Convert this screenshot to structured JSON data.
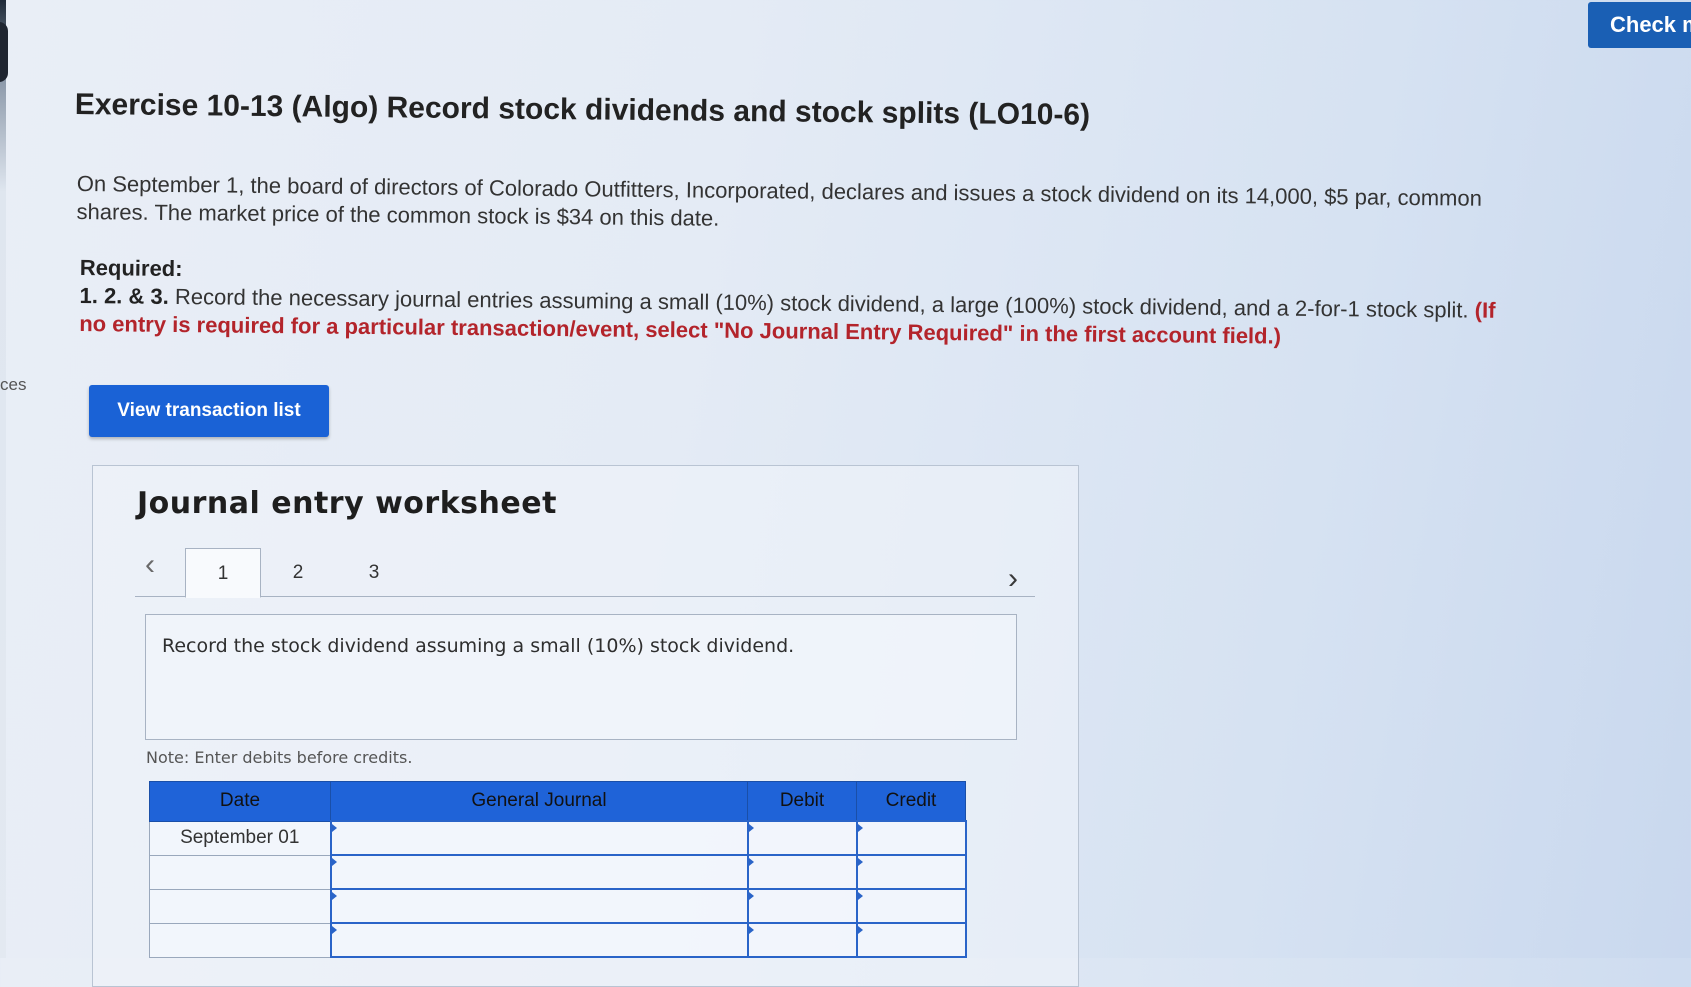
{
  "header": {
    "check_label": "Check m"
  },
  "sidebar": {
    "partial_label": "ces"
  },
  "exercise": {
    "title": "Exercise 10-13 (Algo) Record stock dividends and stock splits (LO10-6)",
    "intro": "On September 1, the board of directors of Colorado Outfitters, Incorporated, declares and issues a stock dividend on its 14,000, $5 par, common shares. The market price of the common stock is $34 on this date.",
    "required_label": "Required:",
    "required_number": "1. 2. & 3.",
    "required_text": " Record the necessary journal entries assuming a small (10%) stock dividend, a large (100%) stock dividend, and a 2-for-1 stock split. ",
    "required_instruction": "(If no entry is required for a particular transaction/event, select \"No Journal Entry Required\" in the first account field.)"
  },
  "buttons": {
    "view_transactions": "View transaction list"
  },
  "worksheet": {
    "title": "Journal entry worksheet",
    "tabs": [
      {
        "label": "1",
        "active": true
      },
      {
        "label": "2",
        "active": false
      },
      {
        "label": "3",
        "active": false
      }
    ],
    "prompt": "Record the stock dividend assuming a small (10%) stock dividend.",
    "note": "Note: Enter debits before credits.",
    "table": {
      "headers": [
        "Date",
        "General Journal",
        "Debit",
        "Credit"
      ],
      "rows": [
        {
          "date": "September 01",
          "account": "",
          "debit": "",
          "credit": ""
        },
        {
          "date": "",
          "account": "",
          "debit": "",
          "credit": ""
        },
        {
          "date": "",
          "account": "",
          "debit": "",
          "credit": ""
        },
        {
          "date": "",
          "account": "",
          "debit": "",
          "credit": ""
        }
      ]
    }
  },
  "icons": {
    "prev": "chevron-left-icon",
    "next": "chevron-right-icon"
  },
  "colors": {
    "primary_button": "#1a62d6",
    "instruction_red": "#b3242b",
    "table_header": "#1f63d8"
  }
}
